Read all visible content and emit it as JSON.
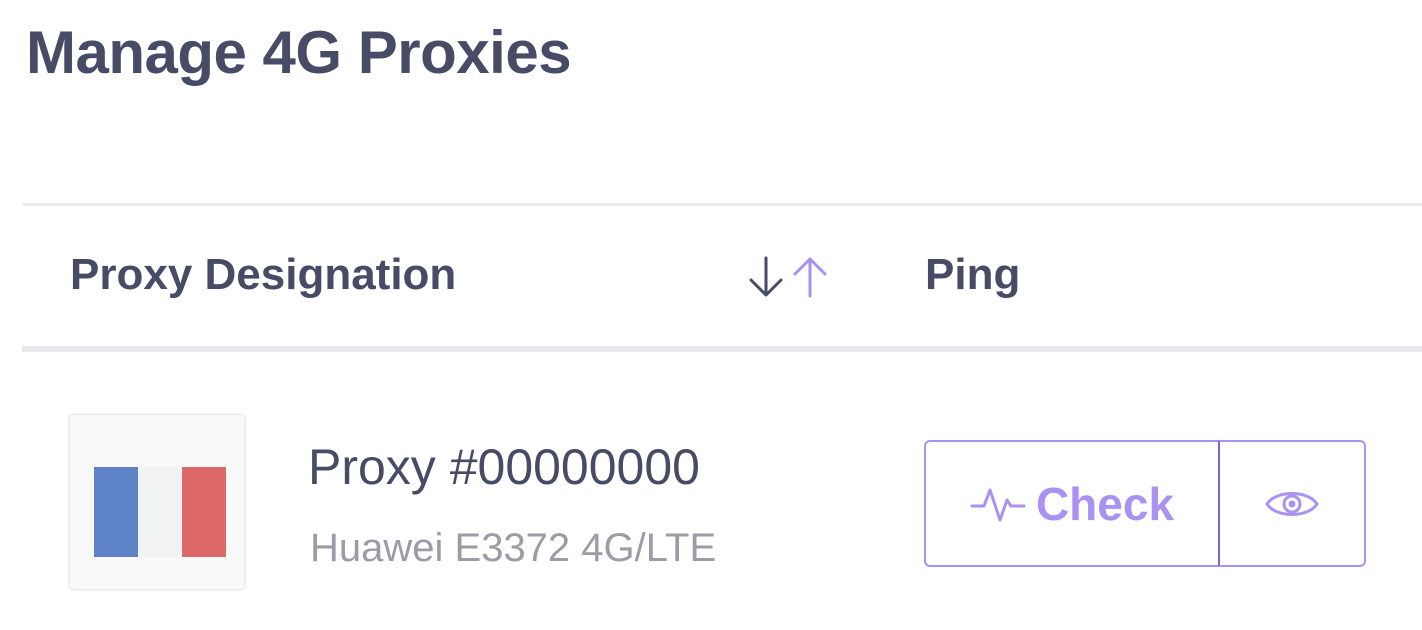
{
  "page": {
    "title": "Manage 4G Proxies"
  },
  "table": {
    "columns": {
      "designation": "Proxy Designation",
      "ping": "Ping"
    },
    "sort_icons": [
      "arrow-down-icon",
      "arrow-up-icon"
    ],
    "rows": [
      {
        "flag_icon": "france-flag-icon",
        "flag_colors": [
          "#5d82c5",
          "#f1f2f3",
          "#dc6868"
        ],
        "name": "Proxy #00000000",
        "model": "Huawei E3372 4G/LTE",
        "check_label": "Check",
        "check_icon": "activity-pulse-icon",
        "view_icon": "eye-icon"
      }
    ]
  },
  "colors": {
    "text_primary": "#474b65",
    "text_muted": "#9b9da6",
    "accent": "#a992f2",
    "accent_dark": "#7a62d8"
  }
}
